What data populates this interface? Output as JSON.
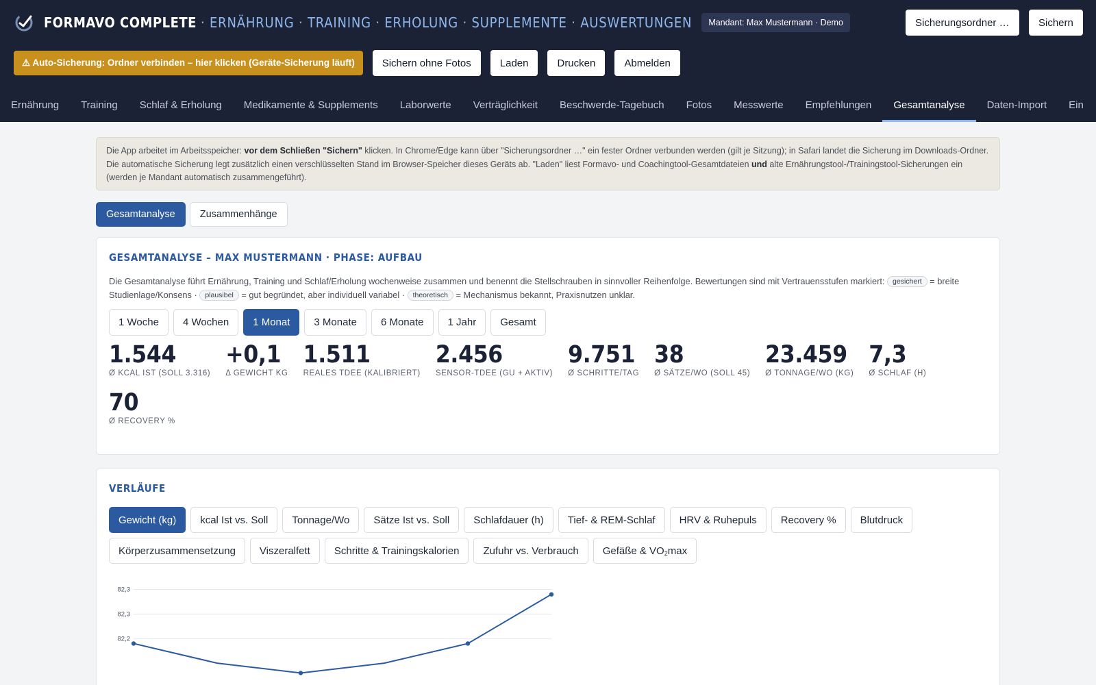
{
  "app": {
    "name": "FORMAVO COMPLETE",
    "sections": "· ERNÄHRUNG · TRAINING · ERHOLUNG · SUPPLEMENTE · AUSWERTUNGEN",
    "tenant_badge": "Mandant: Max Mustermann · Demo"
  },
  "header_buttons": {
    "backup_folder": "Sicherungsordner …",
    "save": "Sichern"
  },
  "actions": {
    "auto_backup": "⚠ Auto-Sicherung: Ordner verbinden – hier klicken (Geräte-Sicherung läuft)",
    "save_without_photos": "Sichern ohne Fotos",
    "load": "Laden",
    "print": "Drucken",
    "logout": "Abmelden"
  },
  "nav": {
    "items": [
      "Ernährung",
      "Training",
      "Schlaf & Erholung",
      "Medikamente & Supplements",
      "Laborwerte",
      "Verträglichkeit",
      "Beschwerde-Tagebuch",
      "Fotos",
      "Messwerte",
      "Empfehlungen",
      "Gesamtanalyse",
      "Daten-Import",
      "Ein"
    ],
    "active_index": 10
  },
  "notice": {
    "t1": "Die App arbeitet im Arbeitsspeicher: ",
    "b1": "vor dem Schließen \"Sichern\"",
    "t2": " klicken. In Chrome/Edge kann über \"Sicherungsordner …\" ein fester Ordner verbunden werden (gilt je Sitzung); in Safari landet die Sicherung im Downloads-Ordner. Die automatische Sicherung legt zusätzlich einen verschlüsselten Stand im Browser-Speicher dieses Geräts ab. \"Laden\" liest Formavo- und Coachingtool-Gesamtdateien ",
    "b2": "und",
    "t3": " alte Ernährungstool-/Trainingstool-Sicherungen ein (werden je Mandant automatisch zusammengeführt)."
  },
  "subtabs": {
    "items": [
      "Gesamtanalyse",
      "Zusammenhänge"
    ],
    "active_index": 0
  },
  "analysis": {
    "title": "Gesamtanalyse – Max Mustermann · Phase: Aufbau",
    "intro_1": "Die Gesamtanalyse führt Ernährung, Training und Schlaf/Erholung wochenweise zusammen und benennt die Stellschrauben in sinnvoller Reihenfolge. Bewertungen sind mit Vertrauensstufen markiert: ",
    "pill_secured": "gesichert",
    "intro_2": " = breite Studienlage/Konsens · ",
    "pill_plausible": "plausibel",
    "intro_3": " = gut begründet, aber individuell variabel · ",
    "pill_theoretical": "theoretisch",
    "intro_4": " = Mechanismus bekannt, Praxisnutzen unklar.",
    "ranges": [
      "1 Woche",
      "4 Wochen",
      "1 Monat",
      "3 Monate",
      "6 Monate",
      "1 Jahr",
      "Gesamt"
    ],
    "active_range_index": 2,
    "kpis": [
      {
        "value": "1.544",
        "label": "Ø kcal Ist (Soll 3.316)"
      },
      {
        "value": "+0,1",
        "label": "Δ Gewicht kg"
      },
      {
        "value": "1.511",
        "label": "Reales TDEE (kalibriert)"
      },
      {
        "value": "2.456",
        "label": "Sensor-TDEE (GU + aktiv)"
      },
      {
        "value": "9.751",
        "label": "Ø Schritte/Tag"
      },
      {
        "value": "38",
        "label": "Ø Sätze/Wo (Soll 45)"
      },
      {
        "value": "23.459",
        "label": "Ø Tonnage/Wo (kg)"
      },
      {
        "value": "7,3",
        "label": "Ø Schlaf (h)"
      },
      {
        "value": "70",
        "label": "Ø Recovery %"
      }
    ]
  },
  "trends": {
    "title": "Verläufe",
    "metrics": [
      "Gewicht (kg)",
      "kcal Ist vs. Soll",
      "Tonnage/Wo",
      "Sätze Ist vs. Soll",
      "Schlafdauer (h)",
      "Tief- & REM-Schlaf",
      "HRV & Ruhepuls",
      "Recovery %",
      "Blutdruck",
      "Körperzusammensetzung",
      "Viszeralfett",
      "Schritte & Trainingskalorien",
      "Zufuhr vs. Verbrauch",
      "Gefäße & VO"
    ],
    "last_metric_sub": "2",
    "last_metric_suffix": "max",
    "active_metric_index": 0
  },
  "chart_data": {
    "type": "line",
    "title": "",
    "xlabel": "",
    "ylabel": "",
    "x": [
      0,
      1,
      2,
      3,
      4,
      5
    ],
    "values": [
      82.19,
      82.15,
      82.13,
      82.15,
      82.19,
      82.29
    ],
    "ylim": [
      82.1,
      82.33
    ],
    "y_ticks": [
      82.2,
      82.25,
      82.3
    ],
    "y_tick_labels": [
      "82,2",
      "82,3",
      "82,3"
    ],
    "grid": true,
    "line_color": "#2c5aa0",
    "grid_color": "#e5e7eb"
  },
  "colors": {
    "header_bg": "#1b2236",
    "accent": "#2c5aa0",
    "warning": "#c8901d",
    "section_text": "#8fb6ea"
  }
}
